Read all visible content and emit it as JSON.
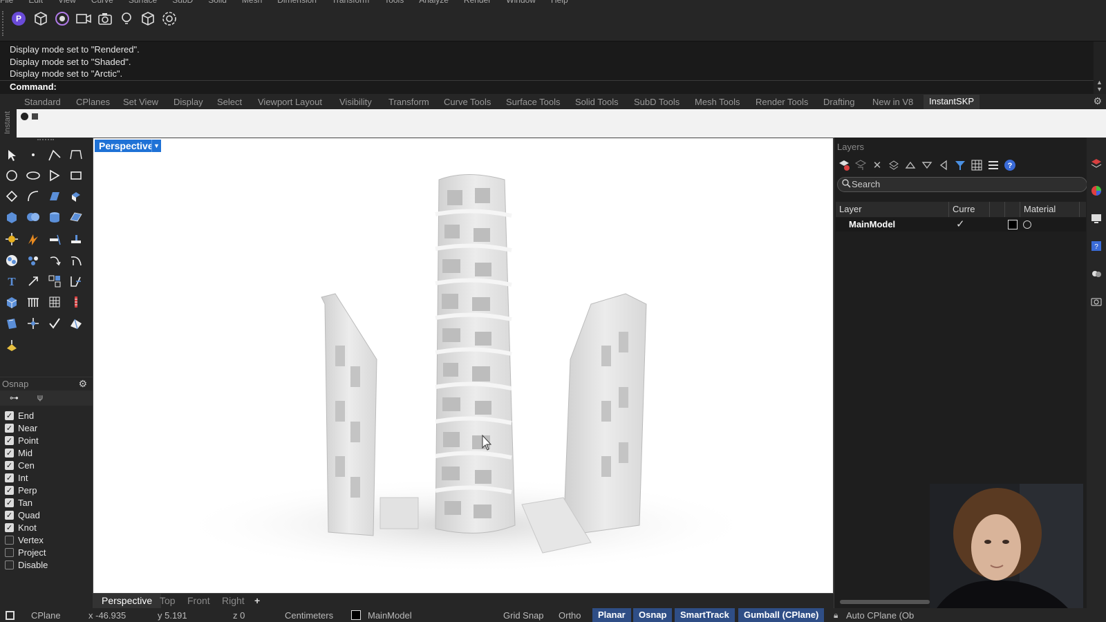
{
  "menu": [
    "File",
    "Edit",
    "View",
    "Curve",
    "Surface",
    "SubD",
    "Solid",
    "Mesh",
    "Dimension",
    "Transform",
    "Tools",
    "Analyze",
    "Render",
    "Window",
    "Help"
  ],
  "top_toolbar_icons": [
    "proxy-logo-icon",
    "box-icon",
    "circle-dot-icon",
    "camera-record-icon",
    "camera-snapshot-icon",
    "lightbulb-icon",
    "box-outline-icon",
    "settings-flower-icon"
  ],
  "command_history": [
    "Display mode set to \"Rendered\".",
    "Display mode set to \"Shaded\".",
    "Display mode set to \"Arctic\"."
  ],
  "command_prompt": "Command:",
  "tabs": [
    "Standard",
    "CPlanes",
    "Set View",
    "Display",
    "Select",
    "Viewport Layout",
    "Visibility",
    "Transform",
    "Curve Tools",
    "Surface Tools",
    "Solid Tools",
    "SubD Tools",
    "Mesh Tools",
    "Render Tools",
    "Drafting",
    "New in V8",
    "InstantSKP"
  ],
  "active_tab": "InstantSKP",
  "instant_label": "Instant",
  "viewport": {
    "title": "Perspective",
    "tabs": [
      "Perspective",
      "Top",
      "Front",
      "Right"
    ],
    "add_tab": "+"
  },
  "osnap": {
    "title": "Osnap",
    "items": [
      {
        "label": "End",
        "checked": true
      },
      {
        "label": "Near",
        "checked": true
      },
      {
        "label": "Point",
        "checked": true
      },
      {
        "label": "Mid",
        "checked": true
      },
      {
        "label": "Cen",
        "checked": true
      },
      {
        "label": "Int",
        "checked": true
      },
      {
        "label": "Perp",
        "checked": true
      },
      {
        "label": "Tan",
        "checked": true
      },
      {
        "label": "Quad",
        "checked": true
      },
      {
        "label": "Knot",
        "checked": true
      },
      {
        "label": "Vertex",
        "checked": false
      },
      {
        "label": "Project",
        "checked": false
      },
      {
        "label": "Disable",
        "checked": false
      }
    ]
  },
  "layers": {
    "title": "Layers",
    "search_placeholder": "Search",
    "columns": {
      "layer": "Layer",
      "current": "Curre",
      "material": "Material"
    },
    "rows": [
      {
        "name": "MainModel",
        "current": true
      }
    ]
  },
  "status": {
    "cplane": "CPlane",
    "x": "x -46.935",
    "y": "y 5.191",
    "z": "z 0",
    "units": "Centimeters",
    "layer": "MainModel",
    "grid_snap": "Grid Snap",
    "ortho": "Ortho",
    "planar": "Planar",
    "osnap": "Osnap",
    "smarttrack": "SmartTrack",
    "gumball": "Gumball (CPlane)",
    "auto_cplane": "Auto CPlane (Ob"
  },
  "colors": {
    "accent_blue": "#1f72d6",
    "status_pill": "#2f4e86",
    "dark_bg": "#1e1e1e",
    "panel_bg": "#262626"
  }
}
